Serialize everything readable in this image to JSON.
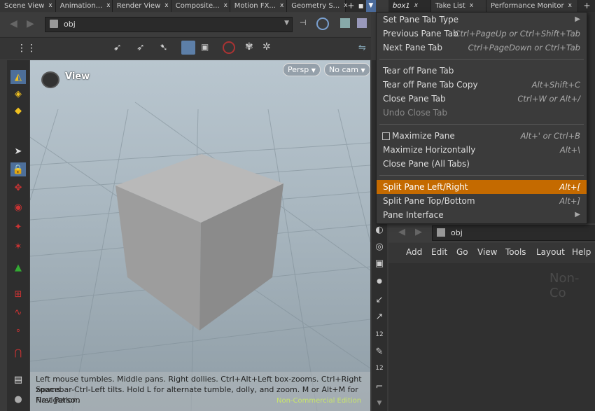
{
  "tabs_left": [
    {
      "label": "Scene View"
    },
    {
      "label": "Animation..."
    },
    {
      "label": "Render View"
    },
    {
      "label": "Composite..."
    },
    {
      "label": "Motion FX..."
    },
    {
      "label": "Geometry S..."
    }
  ],
  "tabs_right": [
    {
      "label": "box1"
    },
    {
      "label": "Take List"
    },
    {
      "label": "Performance Monitor"
    }
  ],
  "close_glyph": "x",
  "add_tab_glyph": "+",
  "viewport": {
    "path": "obj",
    "title": "View",
    "persp_label": "Persp",
    "cam_label": "No cam",
    "help_line1": "Left mouse tumbles. Middle pans. Right dollies. Ctrl+Alt+Left box-zooms. Ctrl+Right zooms.",
    "help_line2": "Spacebar-Ctrl-Left tilts. Hold L for alternate tumble, dolly, and zoom. M or Alt+M for First Person",
    "help_line3": "Navigation.",
    "watermark": "Non-Commercial Edition"
  },
  "menu": {
    "items": [
      {
        "label": "Set Pane Tab Type",
        "shortcut": "▶"
      },
      {
        "label": "Previous Pane Tab",
        "shortcut": "Ctrl+PageUp or Ctrl+Shift+Tab"
      },
      {
        "label": "Next Pane Tab",
        "shortcut": "Ctrl+PageDown or Ctrl+Tab"
      },
      {
        "label": "Tear off Pane Tab",
        "shortcut": ""
      },
      {
        "label": "Tear off Pane Tab Copy",
        "shortcut": "Alt+Shift+C"
      },
      {
        "label": "Close Pane Tab",
        "shortcut": "Ctrl+W or Alt+/"
      },
      {
        "label": "Undo Close Tab",
        "shortcut": ""
      },
      {
        "label": "Maximize Pane",
        "shortcut": "Alt+' or Ctrl+B"
      },
      {
        "label": "Maximize Horizontally",
        "shortcut": "Alt+\\"
      },
      {
        "label": "Close Pane (All Tabs)",
        "shortcut": ""
      },
      {
        "label": "Split Pane Left/Right",
        "shortcut": "Alt+["
      },
      {
        "label": "Split Pane Top/Bottom",
        "shortcut": "Alt+]"
      },
      {
        "label": "Pane Interface",
        "shortcut": "▶"
      }
    ]
  },
  "network": {
    "path": "obj",
    "menubar": [
      "Add",
      "Edit",
      "Go",
      "View",
      "Tools",
      "Layout",
      "Help"
    ],
    "watermark": "Non-Co"
  },
  "colors": {
    "highlight": "#c46a00",
    "accent_orange": "#c46a00"
  }
}
